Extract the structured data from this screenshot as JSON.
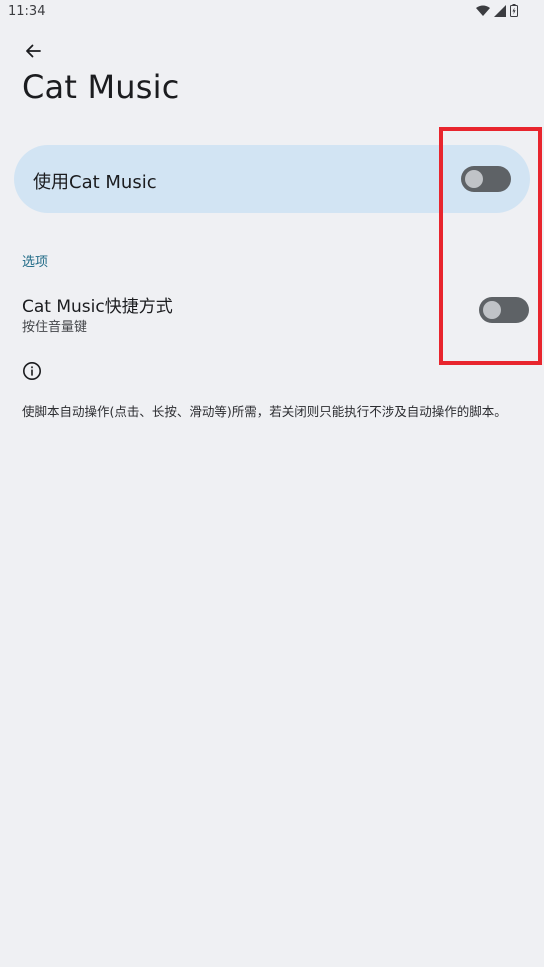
{
  "status_bar": {
    "time": "11:34"
  },
  "header": {
    "title": "Cat Music"
  },
  "main_toggle": {
    "label": "使用Cat Music",
    "state": "off"
  },
  "options": {
    "section_label": "选项",
    "shortcut": {
      "title": "Cat Music快捷方式",
      "subtitle": "按住音量键",
      "state": "off"
    }
  },
  "info": {
    "text": "使脚本自动操作(点击、长按、滑动等)所需，若关闭则只能执行不涉及自动操作的脚本。"
  },
  "colors": {
    "background": "#eff0f3",
    "card": "#d2e4f3",
    "accent": "#1f6a86",
    "switch_track_off": "#5e6266",
    "annotation": "#e8252d"
  },
  "icons": {
    "back": "arrow-back-icon",
    "info": "info-icon",
    "wifi": "wifi-icon",
    "signal": "signal-icon",
    "battery": "battery-icon"
  }
}
